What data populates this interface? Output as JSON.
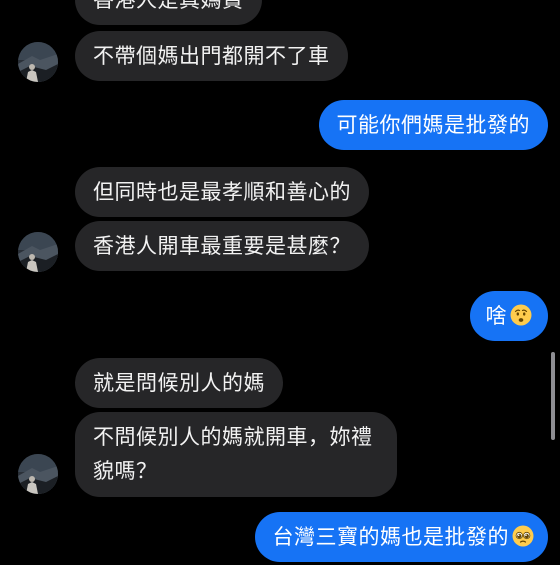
{
  "chat": {
    "messages": [
      {
        "side": "in",
        "text": "香港人是真媽貴"
      },
      {
        "side": "in",
        "text": "不帶個媽出門都開不了車"
      },
      {
        "side": "out",
        "text": "可能你們媽是批發的"
      },
      {
        "side": "in",
        "text": "但同時也是最孝順和善心的"
      },
      {
        "side": "in",
        "text": "香港人開車最重要是甚麼？"
      },
      {
        "side": "out",
        "text": "啥",
        "emoji": "anxious-face"
      },
      {
        "side": "in",
        "text": "就是問候別人的媽"
      },
      {
        "side": "in",
        "text": "不問候別人的媽就開車，妳禮貌嗎？"
      },
      {
        "side": "out",
        "text": "台灣三寶的媽也是批發的",
        "emoji": "pleading-face"
      }
    ]
  },
  "colors": {
    "background": "#000000",
    "incoming_bubble": "#262628",
    "outgoing_bubble": "#1673f5"
  }
}
